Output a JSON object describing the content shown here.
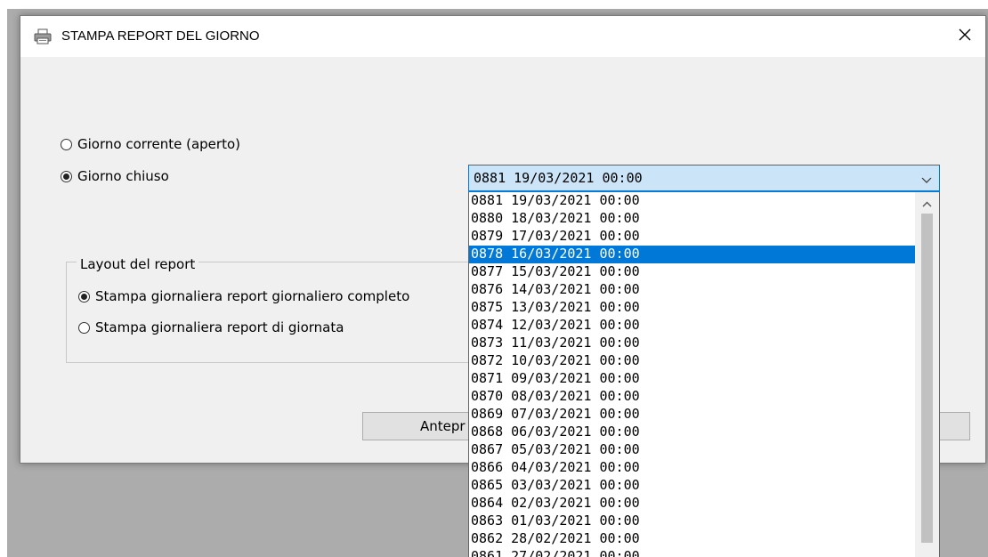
{
  "dialog": {
    "title": "STAMPA REPORT DEL GIORNO",
    "icons": {
      "title": "printer-icon",
      "close": "close-icon"
    }
  },
  "day_selection": {
    "current_day_label": "Giorno corrente (aperto)",
    "closed_day_label": "Giorno chiuso",
    "selected": "closed"
  },
  "day_combo": {
    "value": "0881 19/03/2021 00:00",
    "options": [
      "0881 19/03/2021 00:00",
      "0880 18/03/2021 00:00",
      "0879 17/03/2021 00:00",
      "0878 16/03/2021 00:00",
      "0877 15/03/2021 00:00",
      "0876 14/03/2021 00:00",
      "0875 13/03/2021 00:00",
      "0874 12/03/2021 00:00",
      "0873 11/03/2021 00:00",
      "0872 10/03/2021 00:00",
      "0871 09/03/2021 00:00",
      "0870 08/03/2021 00:00",
      "0869 07/03/2021 00:00",
      "0868 06/03/2021 00:00",
      "0867 05/03/2021 00:00",
      "0866 04/03/2021 00:00",
      "0865 03/03/2021 00:00",
      "0864 02/03/2021 00:00",
      "0863 01/03/2021 00:00",
      "0862 28/02/2021 00:00",
      "0861 27/02/2021 00:00"
    ],
    "highlighted_index": 3
  },
  "layout_group": {
    "label": "Layout del report",
    "option_full": "Stampa giornaliera report giornaliero completo",
    "option_day": "Stampa giornaliera report di giornata",
    "selected": "full"
  },
  "buttons": {
    "preview_label": "Antepr"
  },
  "colors": {
    "selection": "#0078d7",
    "combo_bg": "#cce4f7",
    "dialog_bg": "#f0f0f0"
  }
}
